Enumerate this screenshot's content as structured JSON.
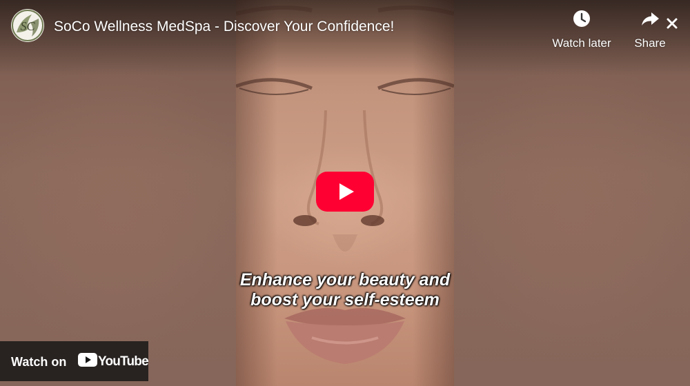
{
  "video": {
    "title": "SoCo Wellness MedSpa - Discover Your Confidence!",
    "channel_logo_text": "SC"
  },
  "actions": {
    "watch_later_label": "Watch later",
    "share_label": "Share"
  },
  "captions": {
    "line1": "Enhance your beauty and",
    "line2": "boost your self-esteem"
  },
  "watch_on": {
    "label": "Watch on",
    "brand": "YouTube"
  },
  "icons": {
    "play": "play-icon",
    "clock": "clock-icon",
    "share": "share-arrow-icon",
    "close": "close-icon",
    "youtube": "youtube-logo-icon"
  },
  "colors": {
    "play_button_red": "#ff0033",
    "side_background": "#866356",
    "skin_tone": "#c9997f",
    "overlay_dark": "#171717"
  }
}
